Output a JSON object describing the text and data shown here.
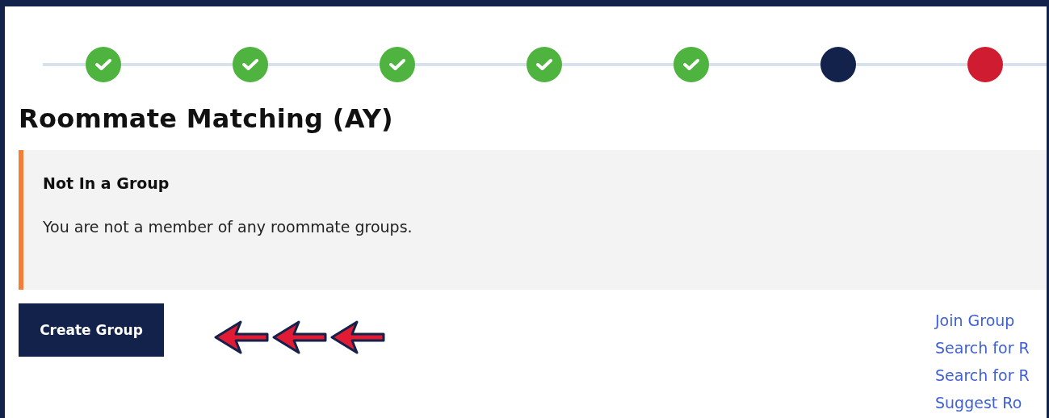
{
  "steps": [
    {
      "completed": true
    },
    {
      "completed": true
    },
    {
      "completed": true
    },
    {
      "completed": true
    },
    {
      "completed": true
    },
    {
      "completed": false,
      "current": true
    },
    {
      "completed": false,
      "current": false
    }
  ],
  "title": "Roommate Matching (AY)",
  "alert": {
    "heading": "Not In a Group",
    "message": "You are not a member of any roommate groups."
  },
  "create_button": "Create Group",
  "links": [
    "Join Group",
    "Search for R",
    "Search for R",
    "Suggest Ro"
  ]
}
